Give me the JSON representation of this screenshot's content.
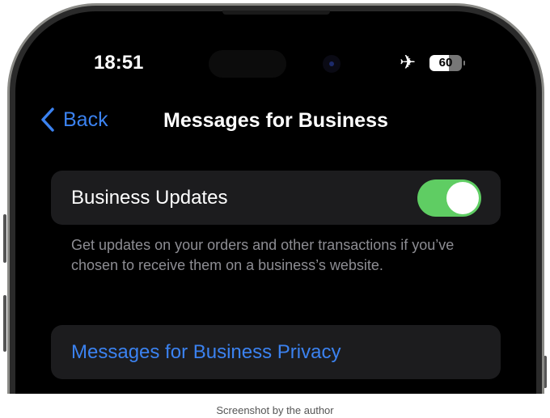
{
  "status_bar": {
    "time": "18:51",
    "airplane_icon": "airplane-icon",
    "battery": "60"
  },
  "nav": {
    "back_label": "Back",
    "title": "Messages for Business"
  },
  "settings": {
    "business_updates": {
      "label": "Business Updates",
      "enabled": true
    },
    "footnote": "Get updates on your orders and other transactions if you’ve chosen to receive them on a business’s website.",
    "privacy_link": "Messages for Business Privacy"
  },
  "caption": "Screenshot by the author",
  "colors": {
    "accent": "#3b82f0",
    "toggle_on": "#5fcd63",
    "card": "#1c1c1e"
  }
}
